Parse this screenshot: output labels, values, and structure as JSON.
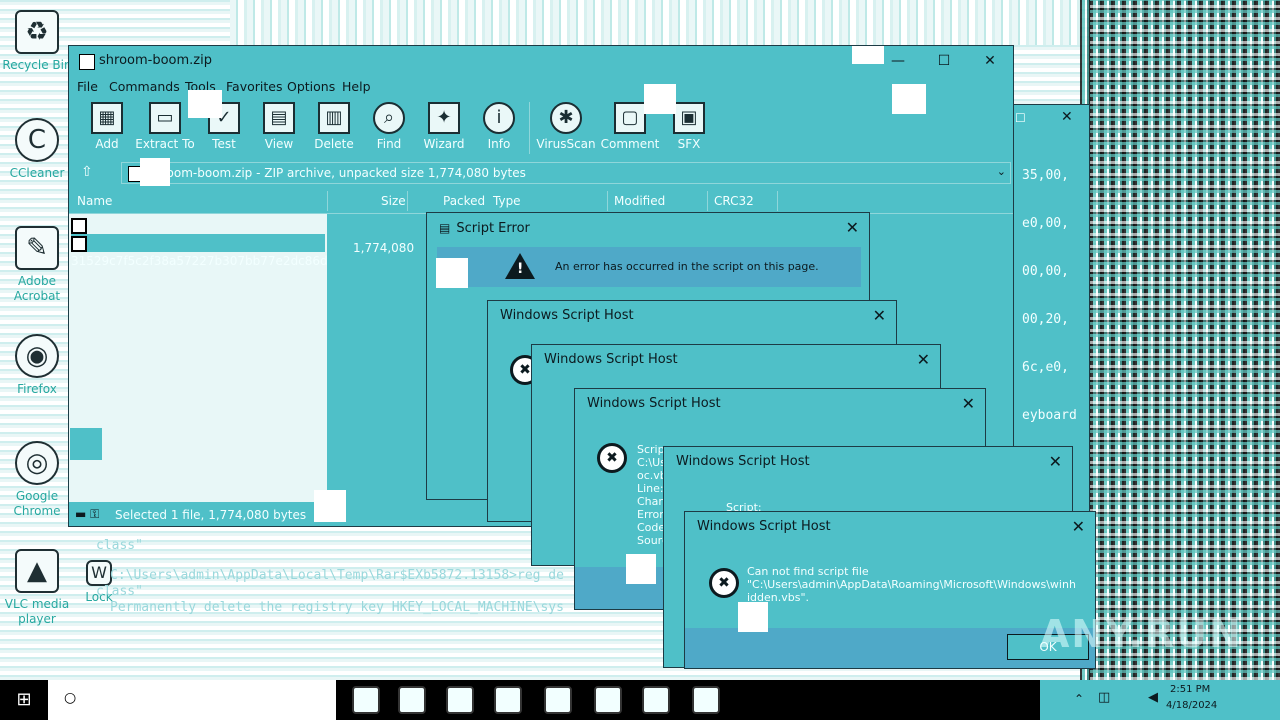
{
  "desktop": {
    "icons": [
      {
        "label": "Recycle Bin",
        "glyph": "recycle-bin"
      },
      {
        "label": "CCleaner",
        "glyph": "ccleaner"
      },
      {
        "label": "Adobe Acrobat",
        "glyph": "acrobat"
      },
      {
        "label": "Firefox",
        "glyph": "firefox"
      },
      {
        "label": "Google Chrome",
        "glyph": "chrome"
      },
      {
        "label": "VLC media player",
        "glyph": "vlc"
      },
      {
        "label": "Lock",
        "glyph": "word-doc"
      }
    ]
  },
  "winrar": {
    "title": "shroom-boom.zip",
    "menu": [
      "File",
      "Commands",
      "Tools",
      "Favorites",
      "Options",
      "Help"
    ],
    "toolbar": [
      "Add",
      "Extract To",
      "Test",
      "View",
      "Delete",
      "Find",
      "Wizard",
      "Info",
      "VirusScan",
      "Comment",
      "SFX"
    ],
    "address": "shroom-boom.zip - ZIP archive, unpacked size 1,774,080 bytes",
    "columns": [
      "Name",
      "Size",
      "Packed",
      "Type",
      "Modified",
      "CRC32"
    ],
    "rows": [
      {
        "name": "",
        "size": ""
      },
      {
        "name": "31529c7f5c2f38a57227b307bb77e2dc86d28...",
        "size": "1,774,080"
      }
    ],
    "status": "Selected 1 file, 1,774,080 bytes"
  },
  "hex": [
    "35,00,",
    "e0,00,",
    "00,00,",
    "00,20,",
    "6c,e0,",
    "eyboard"
  ],
  "console": [
    "class\"",
    "C:\\Users\\admin\\AppData\\Local\\Temp\\Rar$EXb5872.13158>reg de",
    "class\"",
    "Permanently delete the registry key HKEY_LOCAL_MACHINE\\sys"
  ],
  "script_error": {
    "title": "Script Error",
    "message": "An error has occurred in the script on this page."
  },
  "wsh": {
    "title": "Windows Script Host",
    "fields": "Scrip\nC:\\Us\noc.vb\nLine:\nChar:\nError\nCode\nSourc",
    "script_label": "Script:",
    "error_text": "Can not find script file\n\"C:\\Users\\admin\\AppData\\Roaming\\Microsoft\\Windows\\winh\nidden.vbs\".",
    "ok_label": "OK"
  },
  "taskbar": {
    "time": "2:51 PM",
    "date": "4/18/2024"
  },
  "watermark": "ANY.RUN"
}
